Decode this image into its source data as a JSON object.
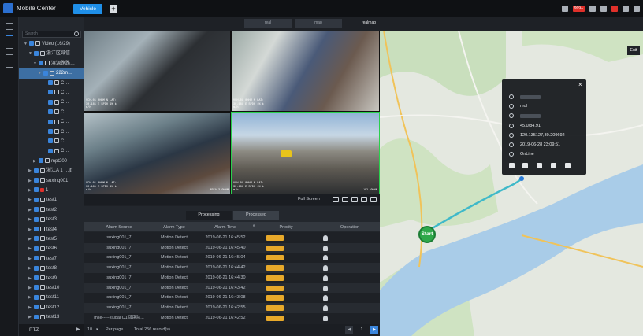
{
  "app": {
    "title": "Mobile Center",
    "tab_vehicle": "Vehicle",
    "add_tab": "+",
    "alarm_count": "999+"
  },
  "view_tabs": [
    "real",
    "map",
    "realmap"
  ],
  "tree": {
    "search_placeholder": "Search",
    "items": [
      {
        "label": "Video (16/29)",
        "indent": 1,
        "arrow": "▼",
        "kind": "root"
      },
      {
        "label": "浙江区域信…",
        "indent": 2,
        "arrow": "▼",
        "kind": "org"
      },
      {
        "label": "滨源路路…",
        "indent": 3,
        "arrow": "▼",
        "kind": "org"
      },
      {
        "label": "222m…",
        "indent": 4,
        "arrow": "▼",
        "kind": "dev",
        "selected": true
      },
      {
        "label": "C…",
        "indent": 5,
        "arrow": "",
        "kind": "cam"
      },
      {
        "label": "C…",
        "indent": 5,
        "arrow": "",
        "kind": "cam"
      },
      {
        "label": "C…",
        "indent": 5,
        "arrow": "",
        "kind": "cam"
      },
      {
        "label": "C…",
        "indent": 5,
        "arrow": "",
        "kind": "cam"
      },
      {
        "label": "C…",
        "indent": 5,
        "arrow": "",
        "kind": "cam"
      },
      {
        "label": "C…",
        "indent": 5,
        "arrow": "",
        "kind": "cam"
      },
      {
        "label": "C…",
        "indent": 5,
        "arrow": "",
        "kind": "cam"
      },
      {
        "label": "C…",
        "indent": 5,
        "arrow": "",
        "kind": "cam"
      },
      {
        "label": "mpt200",
        "indent": 3,
        "arrow": "▶",
        "kind": "dev"
      },
      {
        "label": "浙江A 1 …jtf",
        "indent": 2,
        "arrow": "▶",
        "kind": "org"
      },
      {
        "label": "suxing001",
        "indent": 2,
        "arrow": "▶",
        "kind": "org"
      },
      {
        "label": "1",
        "indent": 2,
        "arrow": "▶",
        "kind": "red"
      },
      {
        "label": "test1",
        "indent": 2,
        "arrow": "▶",
        "kind": "dev"
      },
      {
        "label": "test2",
        "indent": 2,
        "arrow": "▶",
        "kind": "dev"
      },
      {
        "label": "test3",
        "indent": 2,
        "arrow": "▶",
        "kind": "dev"
      },
      {
        "label": "test4",
        "indent": 2,
        "arrow": "▶",
        "kind": "dev"
      },
      {
        "label": "test5",
        "indent": 2,
        "arrow": "▶",
        "kind": "dev"
      },
      {
        "label": "test6",
        "indent": 2,
        "arrow": "▶",
        "kind": "dev"
      },
      {
        "label": "test7",
        "indent": 2,
        "arrow": "▶",
        "kind": "dev"
      },
      {
        "label": "test8",
        "indent": 2,
        "arrow": "▶",
        "kind": "dev"
      },
      {
        "label": "test9",
        "indent": 2,
        "arrow": "▶",
        "kind": "dev"
      },
      {
        "label": "test10",
        "indent": 2,
        "arrow": "▶",
        "kind": "dev"
      },
      {
        "label": "test11",
        "indent": 2,
        "arrow": "▶",
        "kind": "dev"
      },
      {
        "label": "test12",
        "indent": 2,
        "arrow": "▶",
        "kind": "dev"
      },
      {
        "label": "test13",
        "indent": 2,
        "arrow": "▶",
        "kind": "dev"
      }
    ]
  },
  "ptz_label": "PTZ",
  "video": {
    "osd_v1": "VCH-01 0HHM N  LAT:30.181 E  SPD0 1%  km/h",
    "osd_v2": "VCH-01 0HHM N  LAT:30.181 E  SPD0 1%  km/h",
    "osd_v3": "VCH-01 0HHM N  LAT:30.181 E  SPD0 1%  km/h",
    "osd_v4": "VCH-01 0HHM N  LAT:30.181 E  SPD0 1%  km/h",
    "cam_label_v3": "AREA-3 0HHM",
    "cam_label_v4": "VCL-0HHM"
  },
  "video_toolbar": {
    "full_screen": "Full Screen"
  },
  "alarm": {
    "tabs": {
      "processing": "Processing",
      "processed": "Processed"
    },
    "columns": [
      "Alarm Source",
      "Alarm Type",
      "Alarm Time",
      "Priority",
      "Operation"
    ],
    "rows": [
      {
        "source": "suxing001_7",
        "type": "Motion Detect",
        "time": "2019-06-21 16:45:52",
        "priority": "Low"
      },
      {
        "source": "suxing001_7",
        "type": "Motion Detect",
        "time": "2019-06-21 16:45:40",
        "priority": "Low"
      },
      {
        "source": "suxing001_7",
        "type": "Motion Detect",
        "time": "2019-06-21 16:45:04",
        "priority": "Low"
      },
      {
        "source": "suxing001_7",
        "type": "Motion Detect",
        "time": "2019-06-21 16:44:42",
        "priority": "Low"
      },
      {
        "source": "suxing001_7",
        "type": "Motion Detect",
        "time": "2019-06-21 16:44:30",
        "priority": "Low"
      },
      {
        "source": "suxing001_7",
        "type": "Motion Detect",
        "time": "2019-06-21 16:43:42",
        "priority": "Low"
      },
      {
        "source": "suxing001_7",
        "type": "Motion Detect",
        "time": "2019-06-21 16:43:08",
        "priority": "Low"
      },
      {
        "source": "suxing001_7",
        "type": "Motion Detect",
        "time": "2019-06-21 16:42:55",
        "priority": "Low"
      },
      {
        "source": "mse-----xiugai C1回路监...",
        "type": "Motion Detect",
        "time": "2019-06-21 16:42:52",
        "priority": "Low"
      }
    ],
    "footer": {
      "page_size": "10",
      "per_page": "Per page",
      "total": "Total 256 record(s)",
      "page": "1"
    }
  },
  "map": {
    "exit": "Exit",
    "start": "Start",
    "popup": {
      "line2": "mol",
      "speed": "45.0/84.91",
      "coords": "120.135127,30.209692",
      "time": "2019-06-28 23:09:51",
      "status": "OnLine"
    }
  }
}
